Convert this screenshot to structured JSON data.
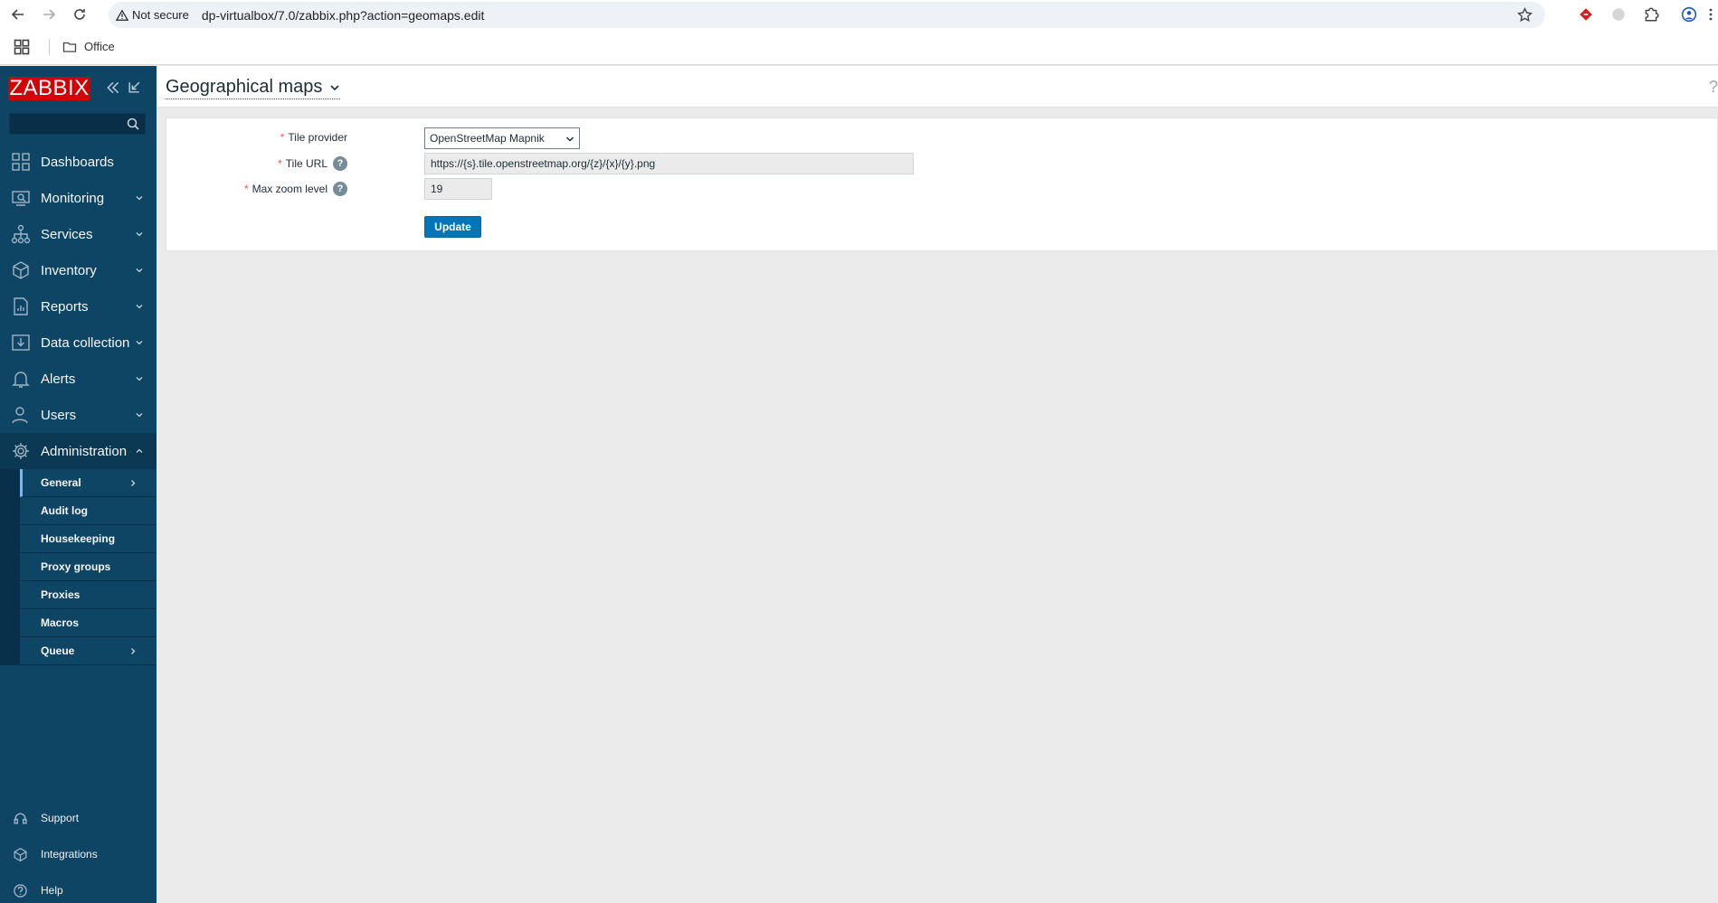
{
  "browser": {
    "security_label": "Not secure",
    "url": "dp-virtualbox/7.0/zabbix.php?action=geomaps.edit",
    "bookmarks": [
      {
        "label": "Office"
      }
    ]
  },
  "sidebar": {
    "logo": "ZABBIX",
    "search": {
      "value": "",
      "placeholder": ""
    },
    "menu": [
      {
        "label": "Dashboards",
        "icon": "dashboards-icon"
      },
      {
        "label": "Monitoring",
        "icon": "monitoring-icon"
      },
      {
        "label": "Services",
        "icon": "services-icon"
      },
      {
        "label": "Inventory",
        "icon": "inventory-icon"
      },
      {
        "label": "Reports",
        "icon": "reports-icon"
      },
      {
        "label": "Data collection",
        "icon": "data-collection-icon"
      },
      {
        "label": "Alerts",
        "icon": "alerts-icon"
      },
      {
        "label": "Users",
        "icon": "users-icon"
      },
      {
        "label": "Administration",
        "icon": "gear-icon",
        "expanded": true
      }
    ],
    "submenu": [
      {
        "label": "General",
        "selected": true,
        "has_children": true
      },
      {
        "label": "Audit log"
      },
      {
        "label": "Housekeeping"
      },
      {
        "label": "Proxy groups"
      },
      {
        "label": "Proxies"
      },
      {
        "label": "Macros"
      },
      {
        "label": "Queue",
        "has_children": true
      }
    ],
    "bottom": [
      {
        "label": "Support",
        "icon": "headset-icon"
      },
      {
        "label": "Integrations",
        "icon": "integrations-icon"
      },
      {
        "label": "Help",
        "icon": "help-icon"
      }
    ]
  },
  "page": {
    "title": "Geographical maps",
    "help": "?"
  },
  "form": {
    "tile_provider": {
      "label": "Tile provider",
      "value": "OpenStreetMap Mapnik"
    },
    "tile_url": {
      "label": "Tile URL",
      "value": "https://{s}.tile.openstreetmap.org/{z}/{x}/{y}.png"
    },
    "max_zoom": {
      "label": "Max zoom level",
      "value": "19"
    },
    "required_mark": "*",
    "help_mark": "?",
    "update_label": "Update"
  },
  "colors": {
    "sidebar_bg": "#0e4464",
    "logo_bg": "#d40000",
    "primary_button": "#0275b8",
    "content_bg": "#ebebeb"
  }
}
